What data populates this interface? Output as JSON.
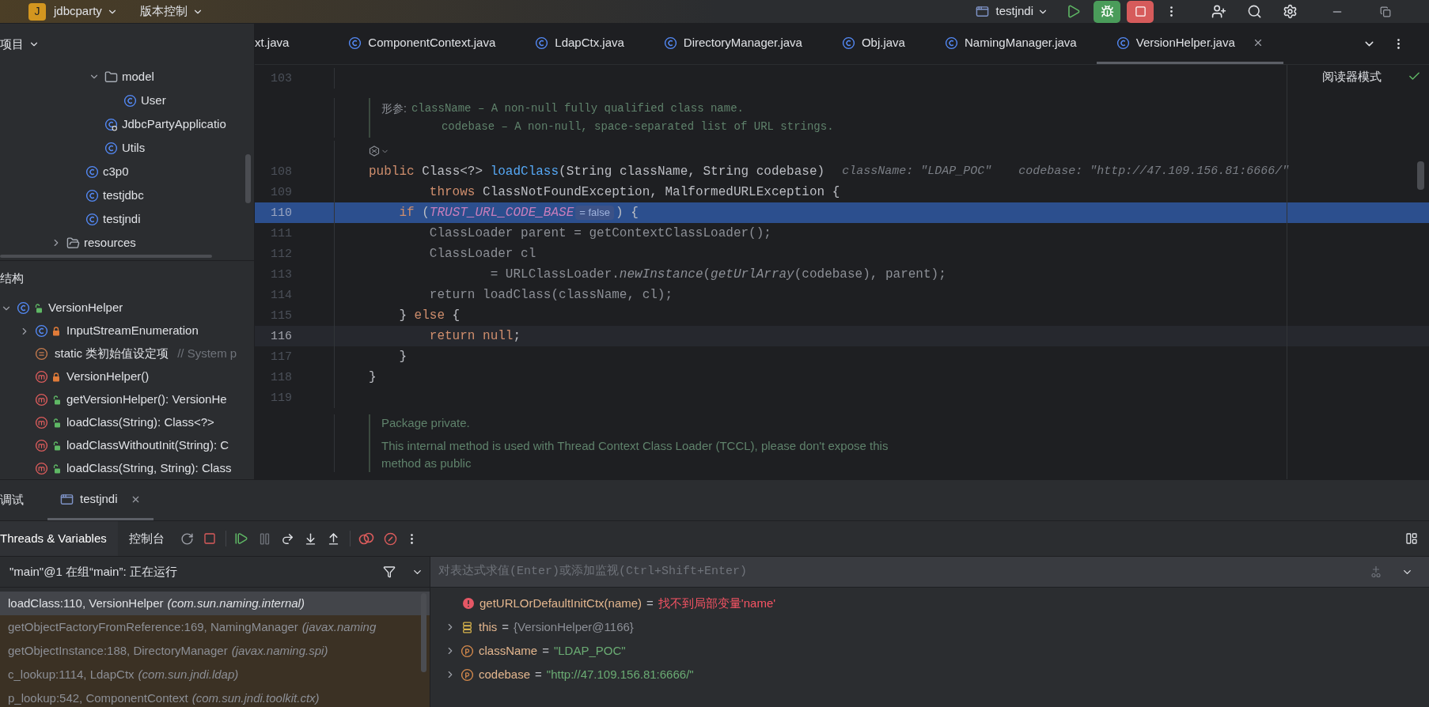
{
  "top_bar": {
    "project_badge": "J",
    "project": "jdbcparty",
    "vcs": "版本控制",
    "run_config": "testjndi"
  },
  "project_panel": {
    "title": "项目",
    "tree": [
      {
        "kind": "continuation",
        "children": [
          {
            "kind": "continuation",
            "children": [
              {
                "kind": "folder",
                "label": "model",
                "expanded": true,
                "children": [
                  {
                    "kind": "class",
                    "label": "User"
                  }
                ]
              },
              {
                "kind": "app-class",
                "label": "JdbcPartyApplicatio"
              },
              {
                "kind": "class",
                "label": "Utils"
              }
            ]
          },
          {
            "kind": "class",
            "label": "c3p0"
          },
          {
            "kind": "class",
            "label": "testjdbc"
          },
          {
            "kind": "class",
            "label": "testjndi"
          }
        ]
      },
      {
        "kind": "resources",
        "label": "resources",
        "expanded": false
      }
    ]
  },
  "structure_panel": {
    "title": "结构",
    "tree": [
      {
        "kind": "class",
        "label": "VersionHelper",
        "private": false,
        "expanded": true,
        "children": [
          {
            "kind": "class",
            "label": "InputStreamEnumeration",
            "private": true,
            "expanded": false
          },
          {
            "kind": "initializer",
            "label": "static 类初始值设定项",
            "comment": "// System p"
          },
          {
            "kind": "method",
            "label": "VersionHelper()",
            "private": true
          },
          {
            "kind": "method",
            "label": "getVersionHelper(): VersionHe",
            "private": false
          },
          {
            "kind": "method",
            "label": "loadClass(String): Class<?>",
            "private": false
          },
          {
            "kind": "method",
            "label": "loadClassWithoutInit(String): C",
            "private": false
          },
          {
            "kind": "method",
            "label": "loadClass(String, String): Class",
            "private": false
          }
        ]
      }
    ]
  },
  "editor_tabs": [
    {
      "label": "xt.java",
      "selected": false
    },
    {
      "label": "ComponentContext.java",
      "selected": false
    },
    {
      "label": "LdapCtx.java",
      "selected": false
    },
    {
      "label": "DirectoryManager.java",
      "selected": false
    },
    {
      "label": "Obj.java",
      "selected": false
    },
    {
      "label": "NamingManager.java",
      "selected": false
    },
    {
      "label": "VersionHelper.java",
      "selected": true
    }
  ],
  "reader_mode": "阅读器模式",
  "code_lines": [
    {
      "kind": "code",
      "number": "103",
      "selected": false,
      "caret": false
    },
    {
      "kind": "param-doc",
      "label": "形参:",
      "lines": [
        "className – A non-null fully qualified class name.",
        "codebase – A non-null, space-separated list of URL strings."
      ]
    },
    {
      "kind": "doc-toggle"
    },
    {
      "kind": "code",
      "number": "108",
      "selected": false,
      "caret": false,
      "segments": [
        {
          "kind": "code",
          "tokens": [
            {
              "text": "public ",
              "kind": "kw"
            },
            {
              "text": "Class<?> ",
              "kind": "plain"
            },
            {
              "text": "loadClass",
              "kind": "decl"
            },
            {
              "text": "(String className, String codebase)",
              "kind": "plain"
            }
          ]
        },
        {
          "kind": "hint",
          "text": "className: \"LDAP_POC\""
        },
        {
          "kind": "hint",
          "text": "codebase: \"http://47.109.156.81:6666/\""
        }
      ]
    },
    {
      "kind": "code",
      "number": "109",
      "selected": false,
      "caret": false,
      "segments": [
        {
          "kind": "code",
          "tokens": [
            {
              "text": "        throws ",
              "kind": "kw"
            },
            {
              "text": "ClassNotFoundException, MalformedURLException {",
              "kind": "plain"
            }
          ]
        }
      ]
    },
    {
      "kind": "code",
      "number": "110",
      "selected": true,
      "caret": false,
      "segments": [
        {
          "kind": "code",
          "tokens": [
            {
              "text": "    if ",
              "kind": "kw"
            },
            {
              "text": "(",
              "kind": "plain"
            },
            {
              "text": "TRUST_URL_CODE_BASE",
              "kind": "const"
            }
          ]
        },
        {
          "kind": "value",
          "text": "= false"
        },
        {
          "kind": "code",
          "tokens": [
            {
              "text": ") {",
              "kind": "plain"
            }
          ]
        }
      ]
    },
    {
      "kind": "code",
      "number": "111",
      "selected": false,
      "caret": false,
      "segments": [
        {
          "kind": "code",
          "tokens": [
            {
              "text": "        ClassLoader parent = getContextClassLoader();",
              "kind": "dim"
            }
          ]
        }
      ]
    },
    {
      "kind": "code",
      "number": "112",
      "selected": false,
      "caret": false,
      "segments": [
        {
          "kind": "code",
          "tokens": [
            {
              "text": "        ClassLoader cl",
              "kind": "dim"
            }
          ]
        }
      ]
    },
    {
      "kind": "code",
      "number": "113",
      "selected": false,
      "caret": false,
      "segments": [
        {
          "kind": "code",
          "tokens": [
            {
              "text": "                = URLClassLoader.",
              "kind": "dim"
            },
            {
              "text": "newInstance",
              "kind": "dim-italic"
            },
            {
              "text": "(",
              "kind": "dim"
            },
            {
              "text": "getUrlArray",
              "kind": "dim-italic"
            },
            {
              "text": "(codebase), parent);",
              "kind": "dim"
            }
          ]
        }
      ]
    },
    {
      "kind": "code",
      "number": "114",
      "selected": false,
      "caret": false,
      "segments": [
        {
          "kind": "code",
          "tokens": [
            {
              "text": "        return loadClass(className, cl);",
              "kind": "dim"
            }
          ]
        }
      ]
    },
    {
      "kind": "code",
      "number": "115",
      "selected": false,
      "caret": false,
      "segments": [
        {
          "kind": "code",
          "tokens": [
            {
              "text": "    } ",
              "kind": "plain"
            },
            {
              "text": "else",
              "kind": "kw"
            },
            {
              "text": " {",
              "kind": "plain"
            }
          ]
        }
      ]
    },
    {
      "kind": "code",
      "number": "116",
      "selected": false,
      "caret": true,
      "segments": [
        {
          "kind": "code",
          "tokens": [
            {
              "text": "        return null",
              "kind": "kw"
            },
            {
              "text": ";",
              "kind": "plain"
            }
          ]
        }
      ]
    },
    {
      "kind": "code",
      "number": "117",
      "selected": false,
      "caret": false,
      "segments": [
        {
          "kind": "code",
          "tokens": [
            {
              "text": "    }",
              "kind": "plain"
            }
          ]
        }
      ]
    },
    {
      "kind": "code",
      "number": "118",
      "selected": false,
      "caret": false,
      "segments": [
        {
          "kind": "code",
          "tokens": [
            {
              "text": "}",
              "kind": "plain"
            }
          ]
        }
      ]
    },
    {
      "kind": "code",
      "number": "119",
      "selected": false,
      "caret": false
    },
    {
      "kind": "text-doc",
      "lines": [
        "Package private.",
        "This internal method is used with Thread Context Class Loader (TCCL), please don't expose this",
        "method as public"
      ]
    }
  ],
  "debug_panel": {
    "title": "调试",
    "tabs": [
      {
        "label": "testjndi",
        "selected": true
      }
    ],
    "view_tabs": [
      {
        "label": "Threads & Variables",
        "selected": true
      },
      {
        "label": "控制台",
        "selected": false
      }
    ],
    "thread": "\"main\"@1 在组“main”: 正在运行",
    "frames": [
      {
        "method": "loadClass:110, VersionHelper",
        "package": "(com.sun.naming.internal)",
        "selected": true
      },
      {
        "method": "getObjectFactoryFromReference:169, NamingManager",
        "package": "(javax.naming",
        "selected": false
      },
      {
        "method": "getObjectInstance:188, DirectoryManager",
        "package": "(javax.naming.spi)",
        "selected": false
      },
      {
        "method": "c_lookup:1114, LdapCtx",
        "package": "(com.sun.jndi.ldap)",
        "selected": false
      },
      {
        "method": "p_lookup:542, ComponentContext",
        "package": "(com.sun.jndi.toolkit.ctx)",
        "selected": false
      }
    ],
    "evaluate_placeholder": "对表达式求值(Enter)或添加监视(Ctrl+Shift+Enter)",
    "variables": [
      {
        "kind": "error",
        "name": "getURLOrDefaultInitCtx(name)",
        "sep": "=",
        "value": "找不到局部变量'name'"
      },
      {
        "kind": "object",
        "name": "this",
        "sep": "=",
        "value": "{VersionHelper@1166}"
      },
      {
        "kind": "param",
        "name": "className",
        "sep": "=",
        "value": "\"LDAP_POC\""
      },
      {
        "kind": "param",
        "name": "codebase",
        "sep": "=",
        "value": "\"http://47.109.156.81:6666/\""
      }
    ]
  }
}
